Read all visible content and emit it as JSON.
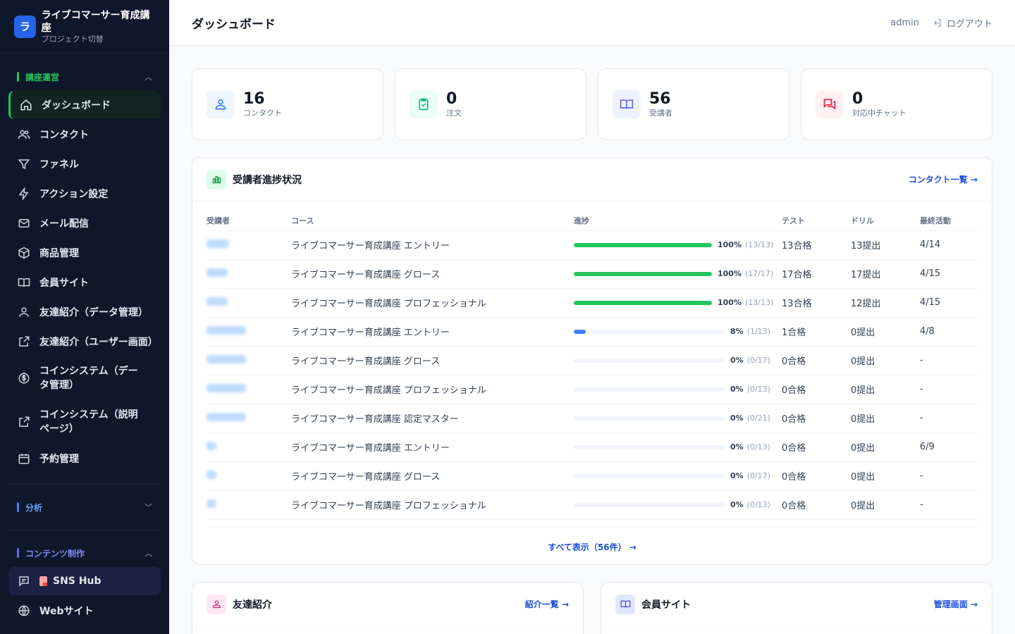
{
  "brand": {
    "logo": "ラ",
    "title": "ライブコマーサー育成講座",
    "subtitle": "プロジェクト切替"
  },
  "sidebar": {
    "sections": [
      {
        "label": "講座運営",
        "color": "#22c55e",
        "chevron": "^"
      },
      {
        "label": "分析",
        "color": "#3b82f6",
        "chevron": "v"
      },
      {
        "label": "コンテンツ制作",
        "color": "#6366f1",
        "chevron": "^"
      }
    ],
    "items": [
      {
        "label": "ダッシュボード",
        "icon": "home-icon"
      },
      {
        "label": "コンタクト",
        "icon": "users-icon"
      },
      {
        "label": "ファネル",
        "icon": "funnel-icon"
      },
      {
        "label": "アクション設定",
        "icon": "lightning-icon"
      },
      {
        "label": "メール配信",
        "icon": "mail-icon"
      },
      {
        "label": "商品管理",
        "icon": "box-icon"
      },
      {
        "label": "会員サイト",
        "icon": "book-icon"
      },
      {
        "label": "友達紹介（データ管理）",
        "icon": "person-icon"
      },
      {
        "label": "友達紹介（ユーザー画面）",
        "icon": "external-link-icon"
      },
      {
        "label": "コインシステム（データ管理）",
        "icon": "dollar-coin-icon"
      },
      {
        "label": "コインシステム（説明ページ）",
        "icon": "external-link-icon"
      },
      {
        "label": "予約管理",
        "icon": "calendar-icon"
      },
      {
        "label": "SNS Hub",
        "icon": "chat-icon"
      },
      {
        "label": "Webサイト",
        "icon": "globe-icon"
      }
    ]
  },
  "header": {
    "title": "ダッシュボード",
    "user": "admin",
    "logout": "ログアウト"
  },
  "stats": [
    {
      "value": "16",
      "label": "コンタクト",
      "icon": "contacts-icon",
      "bg": "#eff6ff",
      "color": "#3b82f6"
    },
    {
      "value": "0",
      "label": "注文",
      "icon": "clipboard-check-icon",
      "bg": "#ecfdf5",
      "color": "#10b981"
    },
    {
      "value": "56",
      "label": "受講者",
      "icon": "book-icon",
      "bg": "#eef2ff",
      "color": "#6366f1"
    },
    {
      "value": "0",
      "label": "対応中チャット",
      "icon": "chat-bubbles-icon",
      "bg": "#fff1f2",
      "color": "#e11d48"
    }
  ],
  "progress": {
    "title": "受講者進捗状況",
    "link": "コンタクト一覧 →",
    "columns": [
      "受講者",
      "コース",
      "進捗",
      "テスト",
      "ドリル",
      "最終活動"
    ],
    "rows": [
      {
        "course": "ライブコマーサー育成講座 エントリー",
        "pct": "100%",
        "frac": "(13/13)",
        "ratio": 1.0,
        "test": "13合格",
        "drill": "13提出",
        "last": "4/14"
      },
      {
        "course": "ライブコマーサー育成講座 グロース",
        "pct": "100%",
        "frac": "(17/17)",
        "ratio": 1.0,
        "test": "17合格",
        "drill": "17提出",
        "last": "4/15"
      },
      {
        "course": "ライブコマーサー育成講座 プロフェッショナル",
        "pct": "100%",
        "frac": "(13/13)",
        "ratio": 1.0,
        "test": "13合格",
        "drill": "12提出",
        "last": "4/15"
      },
      {
        "course": "ライブコマーサー育成講座 エントリー",
        "pct": "8%",
        "frac": "(1/13)",
        "ratio": 0.08,
        "test": "1合格",
        "drill": "0提出",
        "last": "4/8"
      },
      {
        "course": "ライブコマーサー育成講座 グロース",
        "pct": "0%",
        "frac": "(0/17)",
        "ratio": 0,
        "test": "0合格",
        "drill": "0提出",
        "last": "-"
      },
      {
        "course": "ライブコマーサー育成講座 プロフェッショナル",
        "pct": "0%",
        "frac": "(0/13)",
        "ratio": 0,
        "test": "0合格",
        "drill": "0提出",
        "last": "-"
      },
      {
        "course": "ライブコマーサー育成講座 認定マスター",
        "pct": "0%",
        "frac": "(0/21)",
        "ratio": 0,
        "test": "0合格",
        "drill": "0提出",
        "last": "-"
      },
      {
        "course": "ライブコマーサー育成講座 エントリー",
        "pct": "0%",
        "frac": "(0/13)",
        "ratio": 0,
        "test": "0合格",
        "drill": "0提出",
        "last": "6/9"
      },
      {
        "course": "ライブコマーサー育成講座 グロース",
        "pct": "0%",
        "frac": "(0/17)",
        "ratio": 0,
        "test": "0合格",
        "drill": "0提出",
        "last": "-"
      },
      {
        "course": "ライブコマーサー育成講座 プロフェッショナル",
        "pct": "0%",
        "frac": "(0/13)",
        "ratio": 0,
        "test": "0合格",
        "drill": "0提出",
        "last": "-"
      }
    ],
    "show_all": "すべて表示（56件） →"
  },
  "referral": {
    "title": "友達紹介",
    "link": "紹介一覧 →"
  },
  "member_site": {
    "title": "会員サイト",
    "link": "管理画面 →"
  },
  "colors": {
    "accent_blue": "#1d4ed8",
    "progress_full": "#22c55e",
    "progress_partial": "#3b82f6"
  }
}
